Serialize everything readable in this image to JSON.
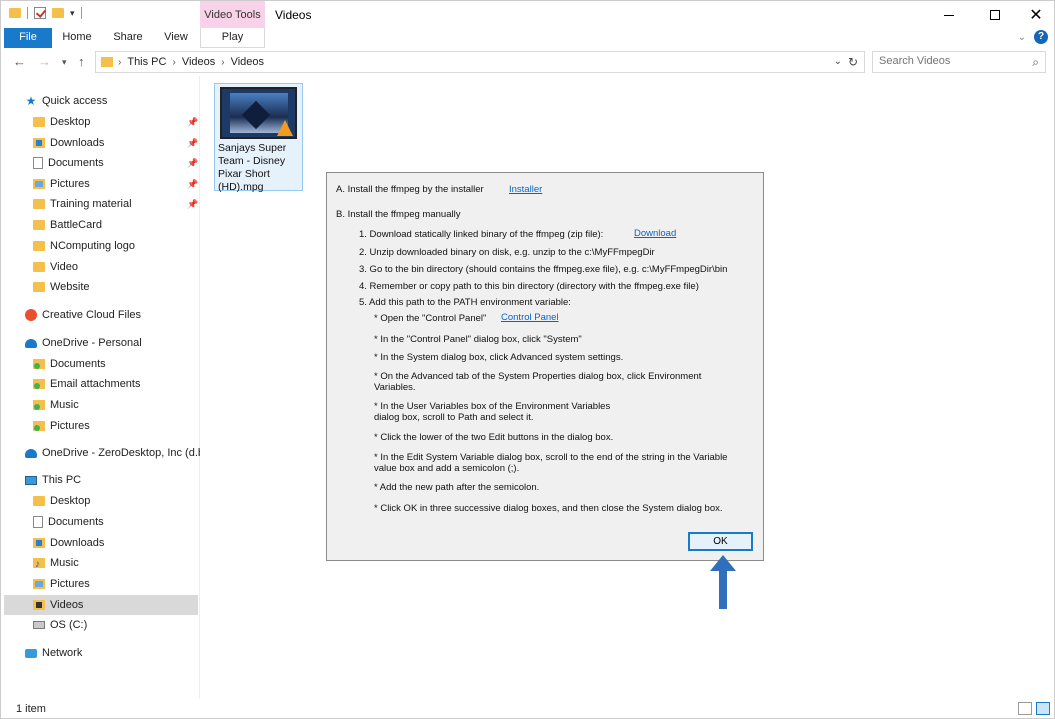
{
  "window": {
    "title": "Videos",
    "context_tab_group": "Video Tools",
    "close_glyph": "✕"
  },
  "ribbon": {
    "tabs": [
      "File",
      "Home",
      "Share",
      "View",
      "Play"
    ]
  },
  "address": {
    "crumbs": [
      "This PC",
      "Videos",
      "Videos"
    ],
    "search_placeholder": "Search Videos"
  },
  "sidebar": {
    "quick_access": "Quick access",
    "quick_items": [
      "Desktop",
      "Downloads",
      "Documents",
      "Pictures",
      "Training material",
      "BattleCard",
      "NComputing logo",
      "Video",
      "Website"
    ],
    "creative_cloud": "Creative Cloud Files",
    "onedrive_personal": "OneDrive - Personal",
    "onedrive_items": [
      "Documents",
      "Email attachments",
      "Music",
      "Pictures"
    ],
    "onedrive_business": "OneDrive - ZeroDesktop, Inc (d.b.a",
    "this_pc": "This PC",
    "pc_items": [
      "Desktop",
      "Documents",
      "Downloads",
      "Music",
      "Pictures",
      "Videos",
      "OS (C:)"
    ],
    "network": "Network",
    "selected": "Videos"
  },
  "content": {
    "file": {
      "name_lines": [
        "Sanjays Super",
        "Team - Disney",
        "Pixar Short",
        "(HD).mpg"
      ]
    }
  },
  "dialog": {
    "lineA": "A. Install the ffmpeg by the installer",
    "installer_link": "Installer",
    "lineB": "B. Install the ffmpeg manually",
    "step1": "1. Download statically linked binary of the ffmpeg (zip file):",
    "download_link": "Download",
    "step2": "2. Unzip downloaded binary on disk, e.g. unzip to the c:\\MyFFmpegDir",
    "step3": "3. Go to the bin directory (should contains the ffmpeg.exe file), e.g. c:\\MyFFmpegDir\\bin",
    "step4": "4. Remember or copy path to this bin directory (directory with the ffmpeg.exe file)",
    "step5": "5. Add this path to the PATH environment variable:",
    "sub_open": "* Open the \"Control Panel\"",
    "control_panel_link": "Control Panel",
    "sub2": "* In the \"Control Panel\" dialog box, click \"System\"",
    "sub3": "* In the System dialog box, click Advanced system settings.",
    "sub4a": "* On the Advanced tab of the System Properties dialog box, click Environment",
    "sub4b": "Variables.",
    "sub5a": "* In the User Variables box of the Environment Variables",
    "sub5b": "dialog box, scroll to Path and select it.",
    "sub6": "* Click the lower of the two Edit buttons in the dialog box.",
    "sub7a": "* In the Edit System Variable dialog box, scroll to the end of the string in the Variable",
    "sub7b": "value box and add a semicolon (;).",
    "sub8": "* Add the new path after the semicolon.",
    "sub9": "* Click OK in three successive dialog boxes, and then close the System dialog box.",
    "ok_label": "OK"
  },
  "status": {
    "item_count": "1 item"
  },
  "colors": {
    "accent": "#1979ca",
    "video_tools": "#f8d2e8",
    "arrow": "#2f6fbd",
    "selection": "#d9d9d9"
  }
}
